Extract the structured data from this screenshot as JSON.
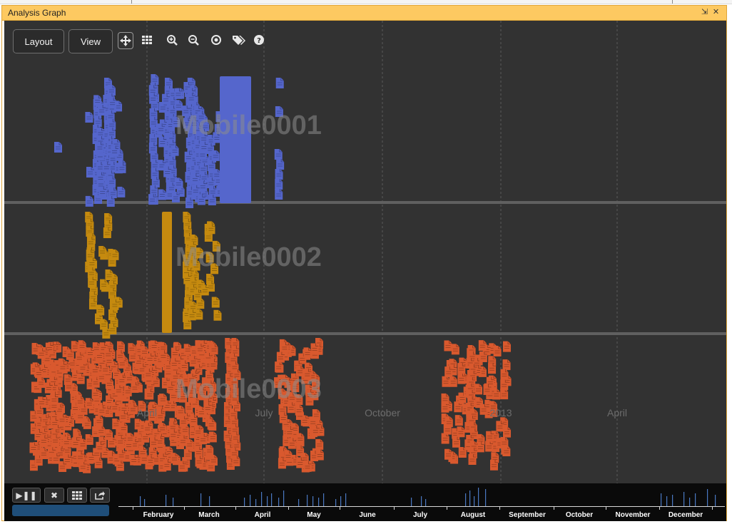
{
  "window": {
    "title": "Analysis Graph",
    "popout_icon": "popout-icon",
    "close_icon": "close-icon"
  },
  "toolbar": {
    "layout_label": "Layout",
    "view_label": "View",
    "icons": [
      "move-icon",
      "grid-icon",
      "zoom-in-icon",
      "zoom-out-icon",
      "target-icon",
      "tags-icon",
      "help-icon"
    ]
  },
  "colors": {
    "graph_background": "#323232",
    "lane_divider": "#606060",
    "mobile0001": "#5566cc",
    "mobile0002": "#c58a0f",
    "mobile0003": "#d9592e",
    "titlebar": "#fdc961"
  },
  "lanes": [
    {
      "label": "Mobile0001",
      "color": "#5566cc"
    },
    {
      "label": "Mobile0002",
      "color": "#c58a0f"
    },
    {
      "label": "Mobile0003",
      "color": "#d9592e"
    }
  ],
  "graph_axis": {
    "labels": [
      "April",
      "July",
      "October",
      "2013",
      "April"
    ]
  },
  "timeline": {
    "buttons": [
      "play-pause-icon",
      "clear-icon",
      "grid-icon",
      "export-icon"
    ],
    "months": [
      "February",
      "March",
      "April",
      "May",
      "June",
      "July",
      "August",
      "September",
      "October",
      "November",
      "December"
    ]
  }
}
